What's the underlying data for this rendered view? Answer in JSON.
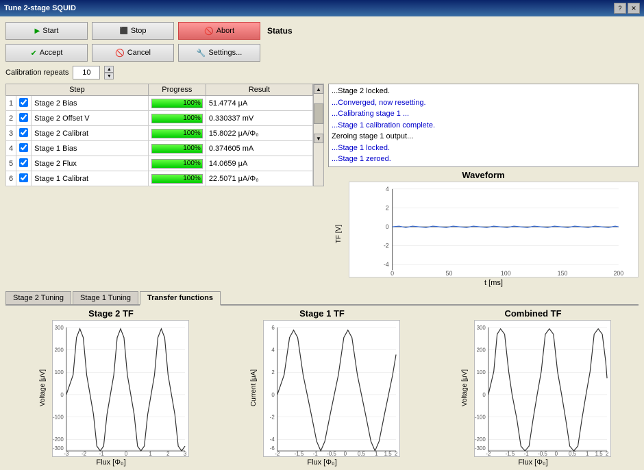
{
  "window": {
    "title": "Tune 2-stage SQUID"
  },
  "buttons": {
    "start": "Start",
    "stop": "Stop",
    "abort": "Abort",
    "accept": "Accept",
    "cancel": "Cancel",
    "settings": "Settings..."
  },
  "calibration": {
    "label": "Calibration repeats",
    "value": "10"
  },
  "status": {
    "label": "Status",
    "lines": [
      {
        "text": "...Stage 2 locked.",
        "color": "black"
      },
      {
        "text": "...Converged, now resetting.",
        "color": "blue"
      },
      {
        "text": "...Calibrating stage 1 ...",
        "color": "blue"
      },
      {
        "text": "...Stage 1 calibration complete.",
        "color": "blue"
      },
      {
        "text": "Zeroing stage 1 output...",
        "color": "black"
      },
      {
        "text": "...Stage 1 locked.",
        "color": "blue"
      },
      {
        "text": "...Stage 1 zeroed.",
        "color": "blue"
      }
    ]
  },
  "table": {
    "headers": [
      "Step",
      "Progress",
      "Result"
    ],
    "rows": [
      {
        "num": "1",
        "checked": true,
        "name": "Stage 2 Bias",
        "progress": 100,
        "result": "51.4774 μA"
      },
      {
        "num": "2",
        "checked": true,
        "name": "Stage 2 Offset V",
        "progress": 100,
        "result": "0.330337 mV"
      },
      {
        "num": "3",
        "checked": true,
        "name": "Stage 2 Calibrat",
        "progress": 100,
        "result": "15.8022 μA/Φ₀"
      },
      {
        "num": "4",
        "checked": true,
        "name": "Stage 1 Bias",
        "progress": 100,
        "result": "0.374605 mA"
      },
      {
        "num": "5",
        "checked": true,
        "name": "Stage 2 Flux",
        "progress": 100,
        "result": "14.0659 μA"
      },
      {
        "num": "6",
        "checked": true,
        "name": "Stage 1 Calibrat",
        "progress": 100,
        "result": "22.5071 μA/Φ₀"
      }
    ]
  },
  "waveform": {
    "title": "Waveform",
    "y_label": "TF [V]",
    "x_label": "t [ms]",
    "y_ticks": [
      "4",
      "2",
      "0",
      "-2",
      "-4"
    ],
    "x_ticks": [
      "0",
      "50",
      "100",
      "150",
      "200"
    ]
  },
  "tabs": {
    "items": [
      "Stage 2 Tuning",
      "Stage 1 Tuning",
      "Transfer functions"
    ],
    "active": 2
  },
  "charts": {
    "stage2_tf": {
      "title": "Stage 2 TF",
      "y_label": "Voltage [μV]",
      "x_label": "Flux [Φ₀]",
      "y_ticks": [
        "300",
        "200",
        "100",
        "0",
        "-100",
        "-200",
        "-300"
      ],
      "x_ticks": [
        "-3",
        "-2",
        "-1",
        "0",
        "1",
        "2",
        "3"
      ]
    },
    "stage1_tf": {
      "title": "Stage 1 TF",
      "y_label": "Current [μA]",
      "x_label": "Flux [Φ₀]",
      "y_ticks": [
        "6",
        "4",
        "2",
        "0",
        "-2",
        "-4",
        "-6"
      ],
      "x_ticks": [
        "-2",
        "-1.5",
        "-1",
        "-0.5",
        "0",
        "0.5",
        "1",
        "1.5",
        "2"
      ]
    },
    "combined_tf": {
      "title": "Combined TF",
      "y_label": "Voltage [μV]",
      "x_label": "Flux [Φ₀]",
      "y_ticks": [
        "300",
        "200",
        "100",
        "0",
        "-100",
        "-200",
        "-300"
      ],
      "x_ticks": [
        "-2",
        "-1.5",
        "-1",
        "-0.5",
        "0",
        "0.5",
        "1",
        "1.5",
        "2"
      ]
    }
  }
}
